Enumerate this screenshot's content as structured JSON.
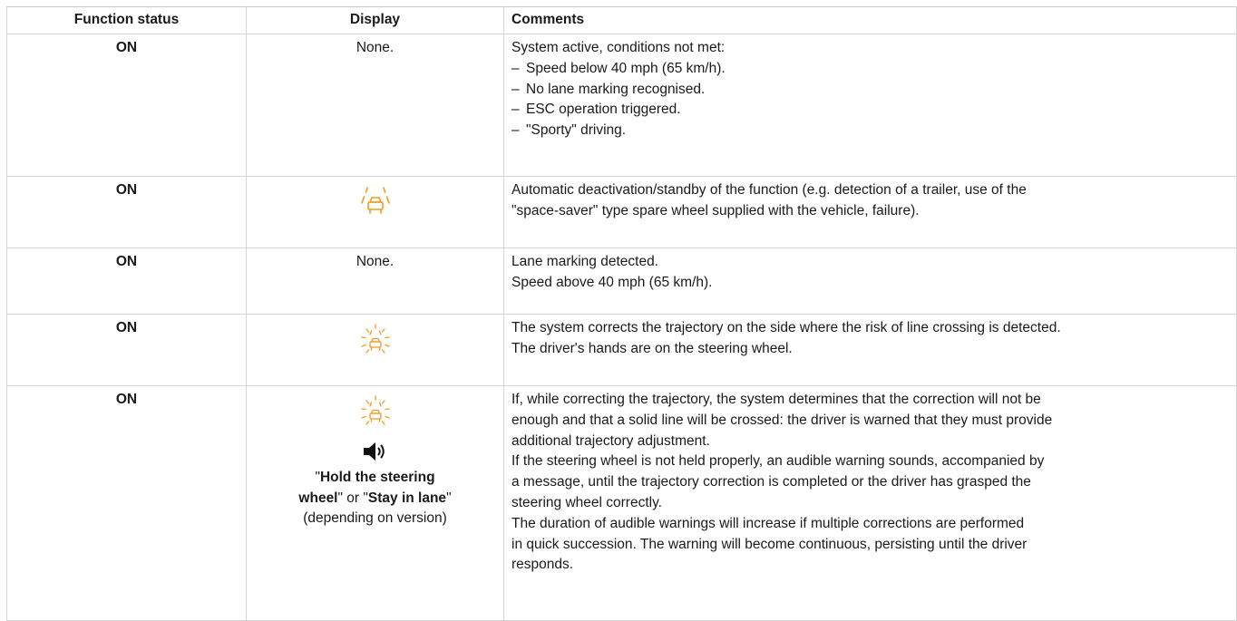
{
  "table": {
    "headers": {
      "status": "Function status",
      "display": "Display",
      "comments": "Comments"
    },
    "rows": [
      {
        "status": "ON",
        "display_text": "None.",
        "comments_intro": "System active, conditions not met:",
        "comments_bullets": [
          "Speed below 40 mph (65 km/h).",
          "No lane marking recognised.",
          "ESC operation triggered.",
          "\"Sporty\" driving."
        ]
      },
      {
        "status": "ON",
        "display_icon": "lane-departure-car-icon",
        "comments_lines": [
          "Automatic deactivation/standby of the function (e.g. detection of a trailer, use of the",
          "\"space-saver\" type spare wheel supplied with the vehicle, failure)."
        ]
      },
      {
        "status": "ON",
        "display_text": "None.",
        "comments_lines": [
          "Lane marking detected.",
          "Speed above 40 mph (65 km/h)."
        ]
      },
      {
        "status": "ON",
        "display_icon": "lane-departure-flashing-icon",
        "comments_lines": [
          "The system corrects the trajectory on the side where the risk of line crossing is detected.",
          "The driver's hands are on the steering wheel."
        ]
      },
      {
        "status": "ON",
        "display_icon": "lane-departure-flashing-icon",
        "display_sound_icon": "speaker-sound-icon",
        "display_msg": {
          "q1": "\"",
          "b1": "Hold the steering",
          "b1b": "wheel",
          "q2": "\" or \"",
          "b2": "Stay in lane",
          "q3": "\"",
          "note": "(depending on version)"
        },
        "comments_lines": [
          "If, while correcting the trajectory, the system determines that the correction will not be",
          "enough and that a solid line will be crossed: the driver is warned that they must provide",
          "additional trajectory adjustment.",
          "If the steering wheel is not held properly, an audible warning sounds, accompanied by",
          "a message, until the trajectory correction is completed or the driver has grasped the",
          "steering wheel correctly.",
          "The duration of audible warnings will increase if multiple corrections are performed",
          "in quick succession. The warning will become continuous, persisting until the driver",
          "responds."
        ]
      }
    ]
  },
  "colors": {
    "icon_orange": "#f39a1e",
    "border": "#d4d4d4",
    "text": "#1a1a1a"
  }
}
